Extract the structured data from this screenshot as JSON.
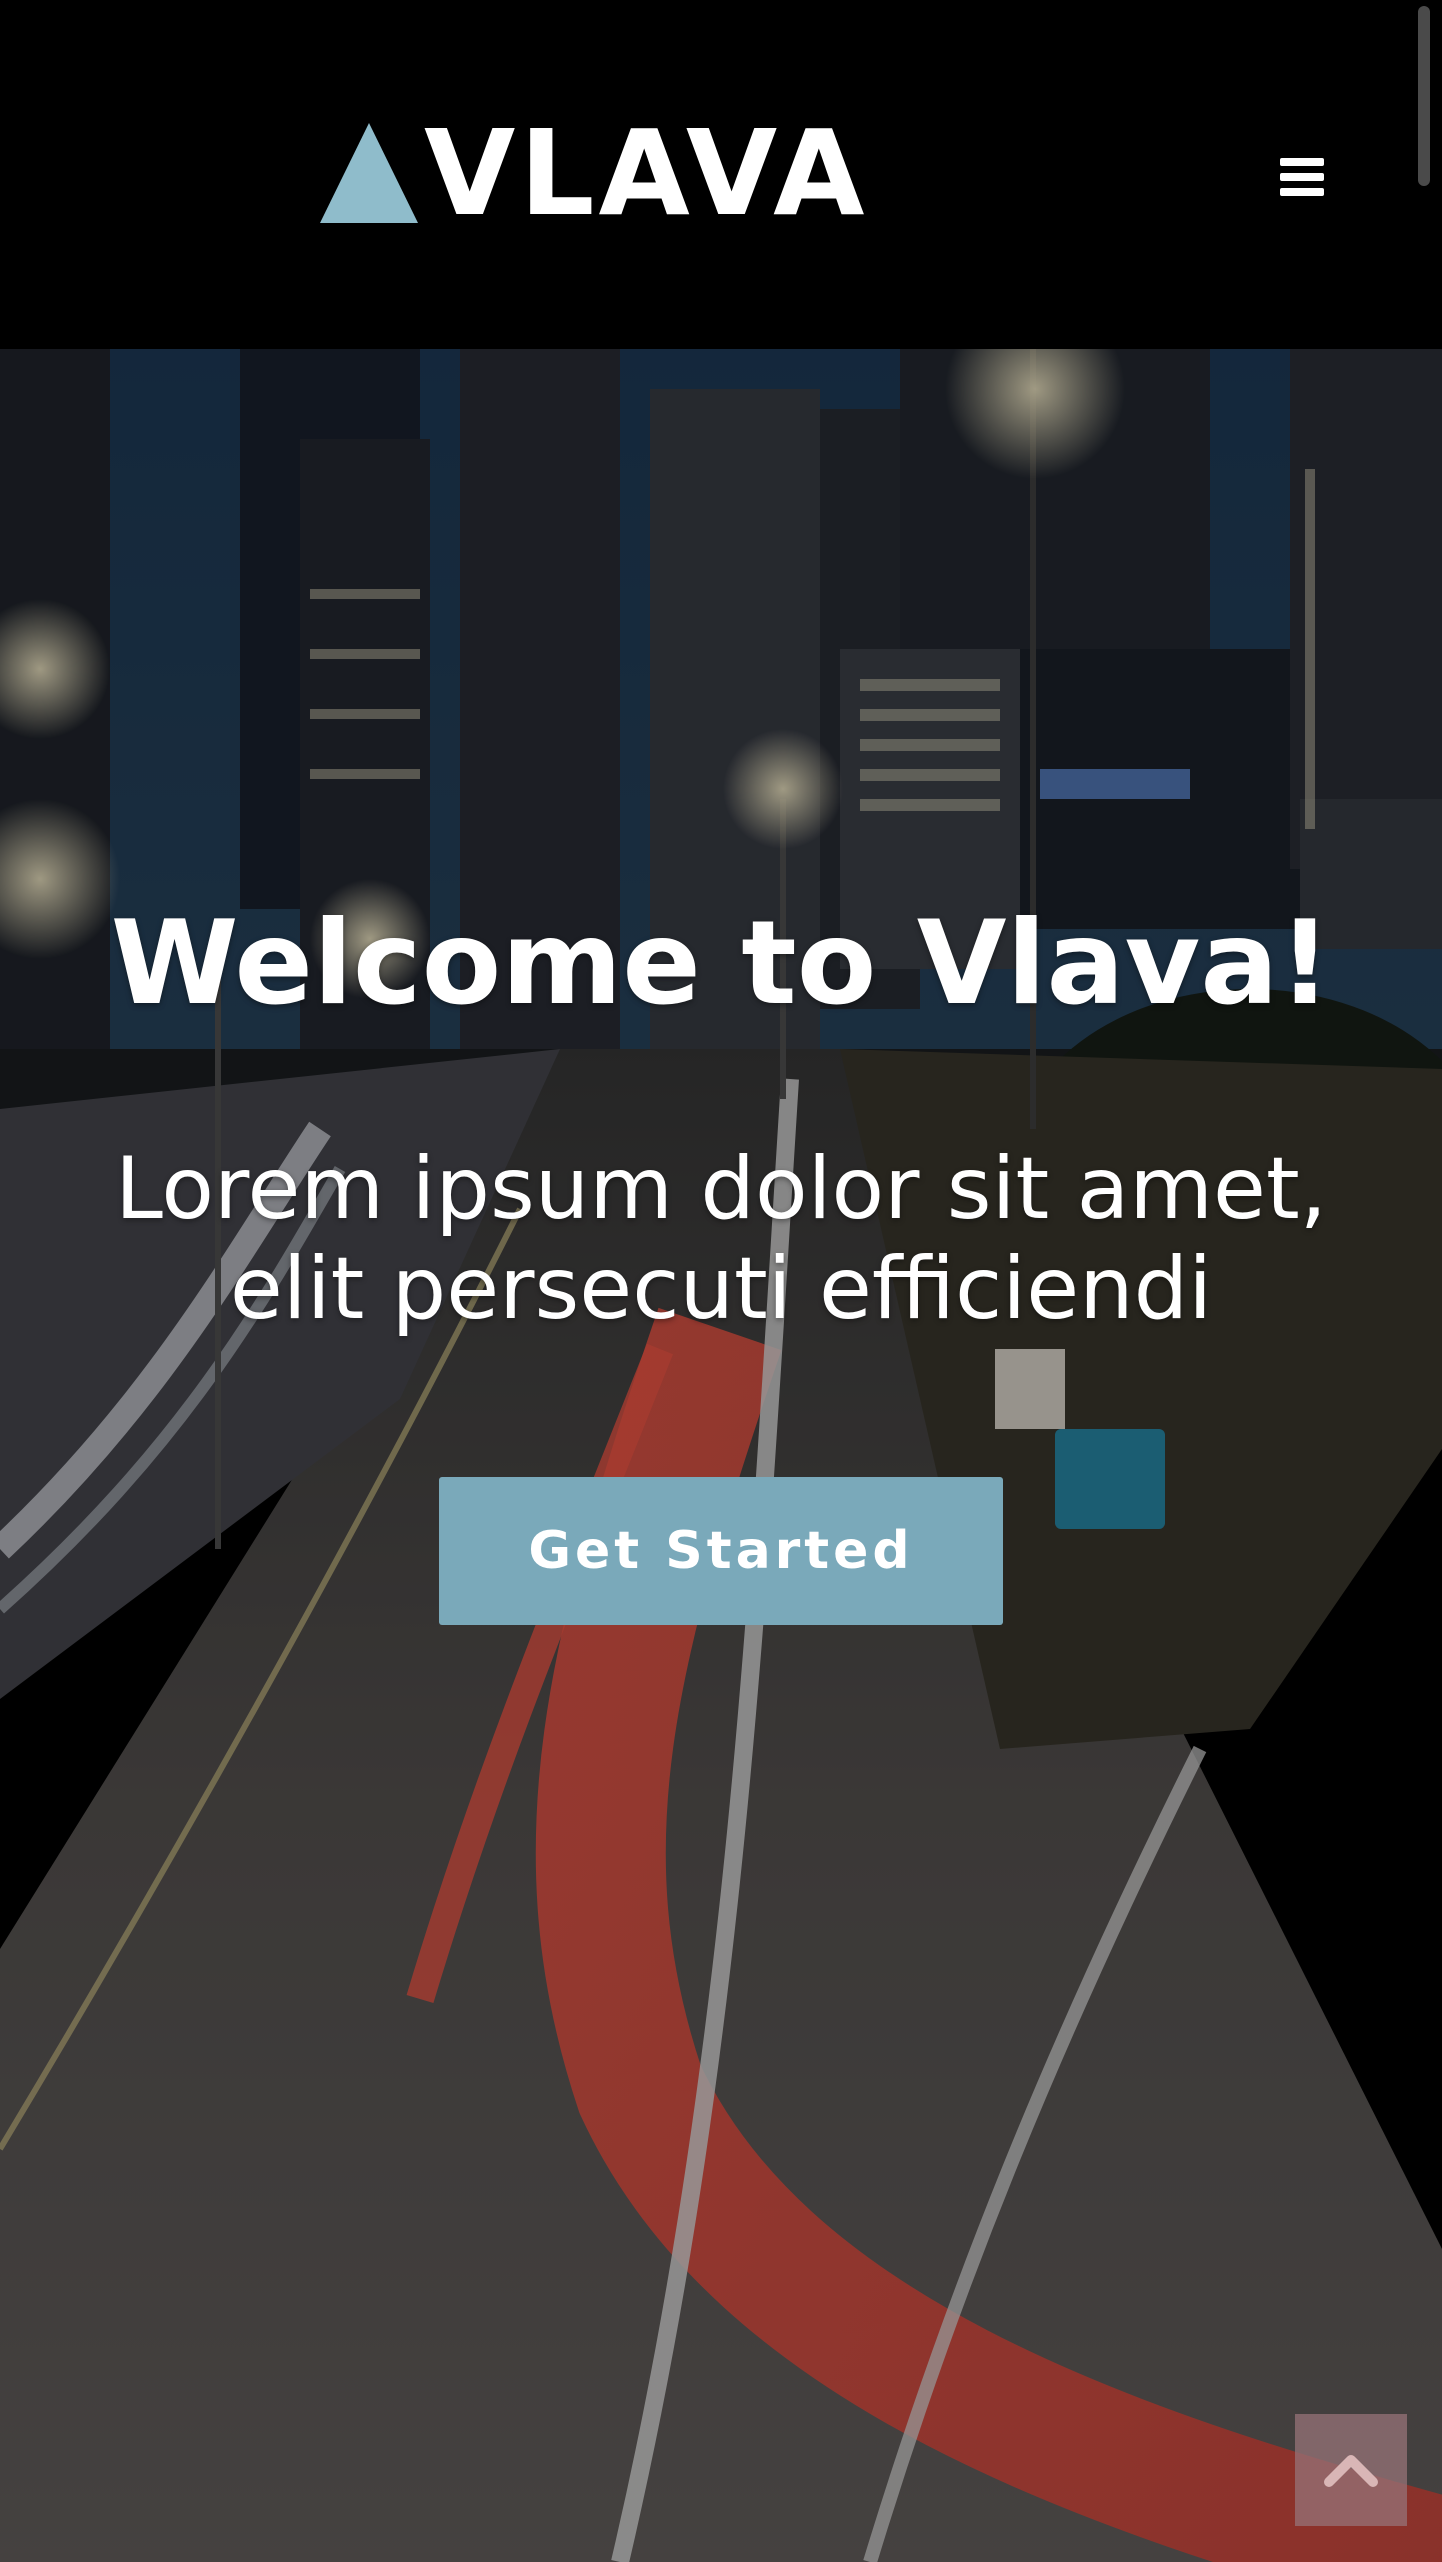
{
  "header": {
    "logo_text": "VLAVA",
    "menu_icon": "hamburger-menu-icon"
  },
  "hero": {
    "title": "Welcome to Vlava!",
    "subtitle_line1": "Lorem ipsum dolor sit amet,",
    "subtitle_line2": "elit persecuti efficiendi",
    "cta_label": "Get Started",
    "background": "night city highway with light trails"
  },
  "back_to_top": {
    "icon": "chevron-up-icon"
  },
  "colors": {
    "accent": "#7aa9ba",
    "header_bg": "#000000",
    "text": "#ffffff",
    "to_top_bg": "#96737a"
  }
}
